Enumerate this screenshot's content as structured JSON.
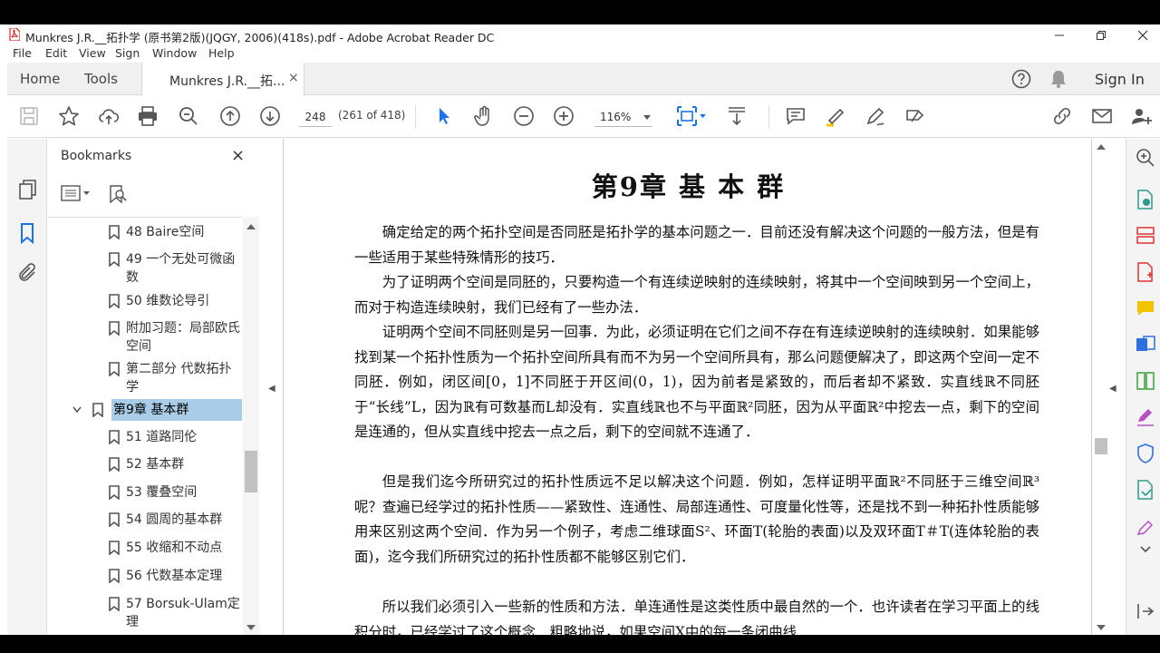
{
  "window": {
    "title": "Munkres J.R.__拓扑学 (原书第2版)(JQGY, 2006)(418s).pdf - Adobe Acrobat Reader DC"
  },
  "menu": [
    "File",
    "Edit",
    "View",
    "Sign",
    "Window",
    "Help"
  ],
  "tabs": {
    "home": "Home",
    "tools": "Tools",
    "document": "Munkres J.R.__拓...",
    "close": "×",
    "sign_in": "Sign In"
  },
  "toolbar": {
    "page_number": "248",
    "page_count": "(261 of 418)",
    "zoom": "116%"
  },
  "bookmarks": {
    "header": "Bookmarks",
    "close": "×",
    "items": [
      {
        "label": "48 Baire空间"
      },
      {
        "label": "49 一个无处可微函数"
      },
      {
        "label": "50 维数论导引"
      },
      {
        "label": "附加习题：局部欧氏空间"
      },
      {
        "label": "第二部分 代数拓扑学"
      },
      {
        "label": "第9章 基本群",
        "selected": true
      },
      {
        "label": "51 道路同伦"
      },
      {
        "label": "52 基本群"
      },
      {
        "label": "53 覆叠空间"
      },
      {
        "label": "54 圆周的基本群"
      },
      {
        "label": "55 收缩和不动点"
      },
      {
        "label": "56 代数基本定理"
      },
      {
        "label": "57 Borsuk-Ulam定理"
      }
    ]
  },
  "page": {
    "chapter_title": "第9章  基  本  群",
    "paragraphs": [
      "确定给定的两个拓扑空间是否同胚是拓扑学的基本问题之一．目前还没有解决这个问题的一般方法，但是有一些适用于某些特殊情形的技巧．",
      "为了证明两个空间是同胚的，只要构造一个有连续逆映射的连续映射，将其中一个空间映到另一个空间上，而对于构造连续映射，我们已经有了一些办法．",
      "证明两个空间不同胚则是另一回事．为此，必须证明在它们之间不存在有连续逆映射的连续映射．如果能够找到某一个拓扑性质为一个拓扑空间所具有而不为另一个空间所具有，那么问题便解决了，即这两个空间一定不同胚．例如，闭区间[0，1]不同胚于开区间(0，1)，因为前者是紧致的，而后者却不紧致．实直线ℝ不同胚于“长线”L，因为ℝ有可数基而L却没有．实直线ℝ也不与平面ℝ²同胚，因为从平面ℝ²中挖去一点，剩下的空间是连通的，但从实直线中挖去一点之后，剩下的空间就不连通了．",
      "但是我们迄今所研究过的拓扑性质远不足以解决这个问题．例如，怎样证明平面ℝ²不同胚于三维空间ℝ³呢？查遍已经学过的拓扑性质——紧致性、连通性、局部连通性、可度量化性等，还是找不到一种拓扑性质能够用来区别这两个空间．作为另一个例子，考虑二维球面S²、环面T(轮胎的表面)以及双环面T＃T(连体轮胎的表面)，迄今我们所研究过的拓扑性质都不能够区别它们．",
      "所以我们必须引入一些新的性质和方法．单连通性是这类性质中最自然的一个．也许读者在学习平面上的线积分时，已经学过了这个概念．粗略地说，如果空间X中的每一条闭曲线"
    ]
  }
}
